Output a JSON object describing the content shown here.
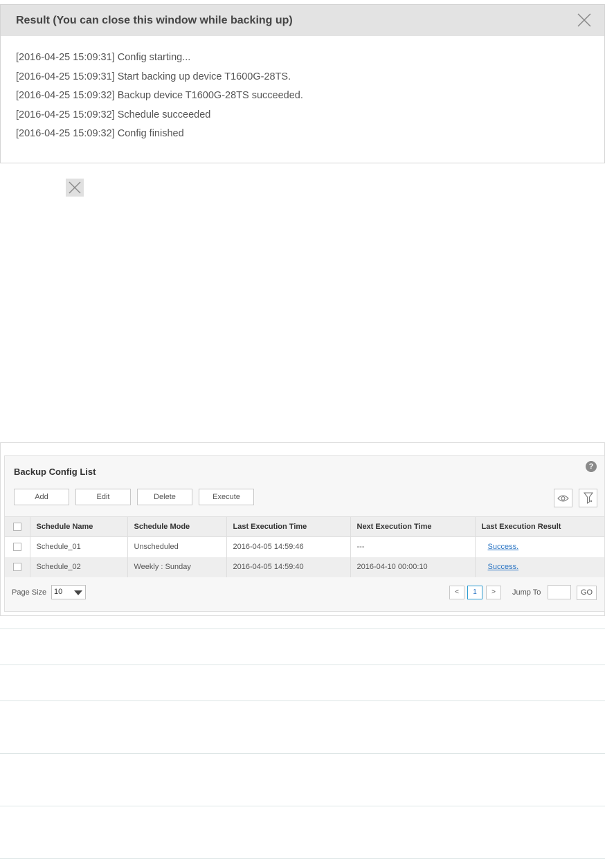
{
  "result_dialog": {
    "title": "Result (You can close this window while backing up)",
    "log": [
      "[2016-04-25 15:09:31] Config starting...",
      "[2016-04-25 15:09:31] Start backing up device T1600G-28TS.",
      "[2016-04-25 15:09:32] Backup device T1600G-28TS succeeded.",
      "[2016-04-25 15:09:32] Schedule succeeded",
      "[2016-04-25 15:09:32] Config finished"
    ]
  },
  "panel": {
    "title": "Backup Config List",
    "help": "?",
    "toolbar": {
      "add": "Add",
      "edit": "Edit",
      "delete": "Delete",
      "execute": "Execute"
    },
    "columns": [
      "Schedule Name",
      "Schedule Mode",
      "Last Execution Time",
      "Next Execution Time",
      "Last Execution Result"
    ],
    "rows": [
      {
        "name": "Schedule_01",
        "mode": "Unscheduled",
        "last": "2016-04-05 14:59:46",
        "next": "---",
        "result": "Success."
      },
      {
        "name": "Schedule_02",
        "mode": "Weekly : Sunday",
        "last": "2016-04-05 14:59:40",
        "next": "2016-04-10 00:00:10",
        "result": "Success."
      }
    ],
    "pager": {
      "page_size_label": "Page Size",
      "page_size": "10",
      "prev": "<",
      "current": "1",
      "next": ">",
      "jump_label": "Jump To",
      "go": "GO"
    }
  },
  "icons": {
    "close": "close-icon",
    "view": "eye-icon",
    "filter": "filter-icon",
    "help": "help-icon"
  }
}
